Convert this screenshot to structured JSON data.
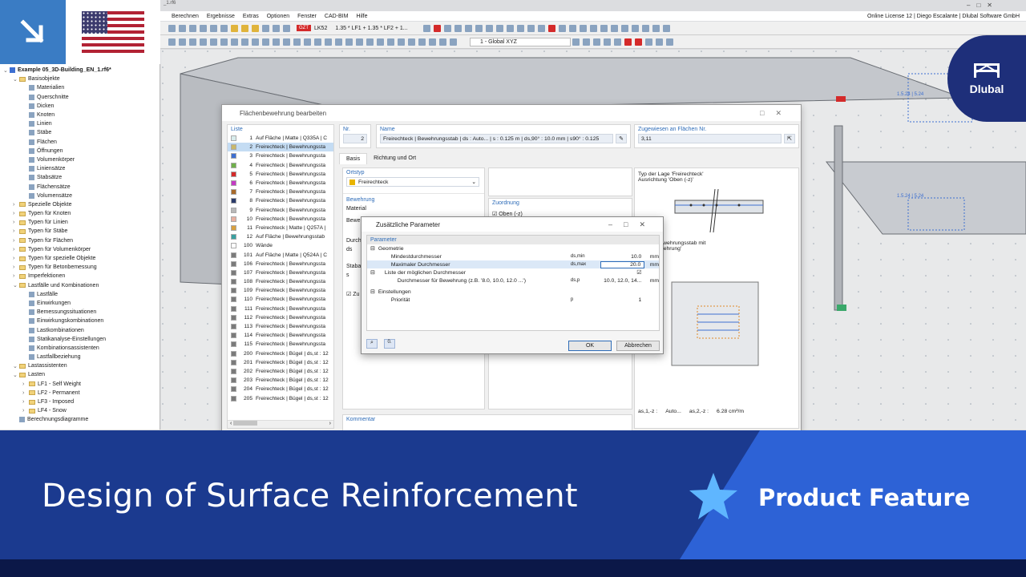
{
  "app": {
    "title_fragment": "_1.rf6",
    "menus": [
      "Berechnen",
      "Ergebnisse",
      "Extras",
      "Optionen",
      "Fenster",
      "CAD-BIM",
      "Hilfe"
    ],
    "license": "Online License 12 | Diego Escalante | Dlubal Software GmbH",
    "load_combo_tag": "GZT",
    "load_combo_id": "LK52",
    "load_combo_formula": "1.35 * LF1 + 1.35 * LF2 + 1...",
    "coordinate_system": "1 - Global XYZ"
  },
  "brand": {
    "name": "Dlubal",
    "accent": "#1e2f7a",
    "corner_blue": "#3a7cc4"
  },
  "tree": {
    "items": [
      {
        "label": "Example 05_3D-Building_EN_1.rf6*",
        "level": 0,
        "type": "file"
      },
      {
        "label": "Basisobjekte",
        "level": 1,
        "type": "folder"
      },
      {
        "label": "Materialien",
        "level": 2,
        "type": "item"
      },
      {
        "label": "Querschnitte",
        "level": 2,
        "type": "item"
      },
      {
        "label": "Dicken",
        "level": 2,
        "type": "item"
      },
      {
        "label": "Knoten",
        "level": 2,
        "type": "item"
      },
      {
        "label": "Linien",
        "level": 2,
        "type": "item"
      },
      {
        "label": "Stäbe",
        "level": 2,
        "type": "item"
      },
      {
        "label": "Flächen",
        "level": 2,
        "type": "item"
      },
      {
        "label": "Öffnungen",
        "level": 2,
        "type": "item"
      },
      {
        "label": "Volumenkörper",
        "level": 2,
        "type": "item"
      },
      {
        "label": "Liniensätze",
        "level": 2,
        "type": "item"
      },
      {
        "label": "Stabsätze",
        "level": 2,
        "type": "item"
      },
      {
        "label": "Flächensätze",
        "level": 2,
        "type": "item"
      },
      {
        "label": "Volumensätze",
        "level": 2,
        "type": "item"
      },
      {
        "label": "Spezielle Objekte",
        "level": 1,
        "type": "folder"
      },
      {
        "label": "Typen für Knoten",
        "level": 1,
        "type": "folder"
      },
      {
        "label": "Typen für Linien",
        "level": 1,
        "type": "folder"
      },
      {
        "label": "Typen für Stäbe",
        "level": 1,
        "type": "folder"
      },
      {
        "label": "Typen für Flächen",
        "level": 1,
        "type": "folder"
      },
      {
        "label": "Typen für Volumenkörper",
        "level": 1,
        "type": "folder"
      },
      {
        "label": "Typen für spezielle Objekte",
        "level": 1,
        "type": "folder"
      },
      {
        "label": "Typen für Betonbemessung",
        "level": 1,
        "type": "folder"
      },
      {
        "label": "Imperfektionen",
        "level": 1,
        "type": "folder"
      },
      {
        "label": "Lastfälle und Kombinationen",
        "level": 1,
        "type": "folder"
      },
      {
        "label": "Lastfälle",
        "level": 2,
        "type": "item"
      },
      {
        "label": "Einwirkungen",
        "level": 2,
        "type": "item"
      },
      {
        "label": "Bemessungssituationen",
        "level": 2,
        "type": "item"
      },
      {
        "label": "Einwirkungskombinationen",
        "level": 2,
        "type": "item"
      },
      {
        "label": "Lastkombinationen",
        "level": 2,
        "type": "item"
      },
      {
        "label": "Statikanalyse-Einstellungen",
        "level": 2,
        "type": "item"
      },
      {
        "label": "Kombinationsassistenten",
        "level": 2,
        "type": "item"
      },
      {
        "label": "Lastfallbeziehung",
        "level": 2,
        "type": "item"
      },
      {
        "label": "Lastassistenten",
        "level": 1,
        "type": "folder"
      },
      {
        "label": "Lasten",
        "level": 1,
        "type": "folder"
      },
      {
        "label": "LF1 - Self Weight",
        "level": 2,
        "type": "folder"
      },
      {
        "label": "LF2 - Permanent",
        "level": 2,
        "type": "folder"
      },
      {
        "label": "LF3 - Imposed",
        "level": 2,
        "type": "folder"
      },
      {
        "label": "LF4 - Snow",
        "level": 2,
        "type": "folder"
      },
      {
        "label": "Berechnungsdiagramme",
        "level": 1,
        "type": "item"
      }
    ]
  },
  "dialog": {
    "title": "Flächenbewehrung bearbeiten",
    "list_header": "Liste",
    "nr_header": "Nr.",
    "nr_value": "2",
    "name_header": "Name",
    "name_value": "Freirechteck | Bewehrungsstab | ds : Auto... | s : 0.125 m | ds,90° : 10.0 mm | s90° : 0.125",
    "assigned_header": "Zugewiesen an Flächen Nr.",
    "assigned_value": "3,11",
    "tabs": [
      "Basis",
      "Richtung und Ort"
    ],
    "ortstyp_label": "Ortstyp",
    "ortstyp_value": "Freirechteck",
    "bewehrung_label": "Bewehrung",
    "material_label": "Material",
    "zuordnung_label": "Zuordnung",
    "oben_label": "Oben (-z)",
    "kommentar_label": "Kommentar",
    "preview_text1": "Typ der Lage 'Freirechteck'",
    "preview_text2": "Ausrichtung 'Oben (-z)'",
    "preview_text3": "sgstyp 'Bewehrungsstab mit",
    "preview_text4": "r Querbewehrung'",
    "area_label1": "as,1,-z :",
    "area_value1": "Auto...",
    "area_label2": "as,2,-z :",
    "area_value2": "6.28 cm²/m",
    "partial_labels": [
      "Bewe",
      "Durch",
      "ds",
      "Staba",
      "s",
      "Zu",
      "a",
      "ja"
    ],
    "list_items": [
      {
        "nr": "1",
        "text": "Auf Fläche | Matte | Q335A | C",
        "color": "#d8ecec"
      },
      {
        "nr": "2",
        "text": "Freirechteck | Bewehrungssta",
        "color": "#c9b86b",
        "selected": true
      },
      {
        "nr": "3",
        "text": "Freirechteck | Bewehrungssta",
        "color": "#3d6fd1"
      },
      {
        "nr": "4",
        "text": "Freirechteck | Bewehrungssta",
        "color": "#6fb04a"
      },
      {
        "nr": "5",
        "text": "Freirechteck | Bewehrungssta",
        "color": "#d42a2a"
      },
      {
        "nr": "6",
        "text": "Freirechteck | Bewehrungssta",
        "color": "#c43ac4"
      },
      {
        "nr": "7",
        "text": "Freirechteck | Bewehrungssta",
        "color": "#a86a2a"
      },
      {
        "nr": "8",
        "text": "Freirechteck | Bewehrungssta",
        "color": "#2a3a6a"
      },
      {
        "nr": "9",
        "text": "Freirechteck | Bewehrungssta",
        "color": "#b8b8b8"
      },
      {
        "nr": "10",
        "text": "Freirechteck | Bewehrungssta",
        "color": "#e8b0a0"
      },
      {
        "nr": "11",
        "text": "Freirechteck | Matte | Q257A |",
        "color": "#d8a040"
      },
      {
        "nr": "12",
        "text": "Auf Fläche | Bewehrungsstab",
        "color": "#3aa0a0"
      },
      {
        "nr": "100",
        "text": "Wände",
        "color": "#ffffff"
      },
      {
        "nr": "101",
        "text": "Auf Fläche | Matte | Q524A | C",
        "color": "#7a7a7a"
      },
      {
        "nr": "106",
        "text": "Freirechteck | Bewehrungssta",
        "color": "#7a7a7a"
      },
      {
        "nr": "107",
        "text": "Freirechteck | Bewehrungssta",
        "color": "#7a7a7a"
      },
      {
        "nr": "108",
        "text": "Freirechteck | Bewehrungssta",
        "color": "#7a7a7a"
      },
      {
        "nr": "109",
        "text": "Freirechteck | Bewehrungssta",
        "color": "#7a7a7a"
      },
      {
        "nr": "110",
        "text": "Freirechteck | Bewehrungssta",
        "color": "#7a7a7a"
      },
      {
        "nr": "111",
        "text": "Freirechteck | Bewehrungssta",
        "color": "#7a7a7a"
      },
      {
        "nr": "112",
        "text": "Freirechteck | Bewehrungssta",
        "color": "#7a7a7a"
      },
      {
        "nr": "113",
        "text": "Freirechteck | Bewehrungssta",
        "color": "#7a7a7a"
      },
      {
        "nr": "114",
        "text": "Freirechteck | Bewehrungssta",
        "color": "#7a7a7a"
      },
      {
        "nr": "115",
        "text": "Freirechteck | Bewehrungssta",
        "color": "#7a7a7a"
      },
      {
        "nr": "200",
        "text": "Freirechteck | Bügel | ds,st : 12",
        "color": "#7a7a7a"
      },
      {
        "nr": "201",
        "text": "Freirechteck | Bügel | ds,st : 12",
        "color": "#7a7a7a"
      },
      {
        "nr": "202",
        "text": "Freirechteck | Bügel | ds,st : 12",
        "color": "#7a7a7a"
      },
      {
        "nr": "203",
        "text": "Freirechteck | Bügel | ds,st : 12",
        "color": "#7a7a7a"
      },
      {
        "nr": "204",
        "text": "Freirechteck | Bügel | ds,st : 12",
        "color": "#7a7a7a"
      },
      {
        "nr": "205",
        "text": "Freirechteck | Bügel | ds,st : 12",
        "color": "#7a7a7a"
      }
    ]
  },
  "subdialog": {
    "title": "Zusätzliche Parameter",
    "param_header": "Parameter",
    "rows": [
      {
        "label": "Geometrie",
        "sym": "",
        "value": "",
        "unit": "",
        "indent": 0,
        "group": true
      },
      {
        "label": "Mindestdurchmesser",
        "sym": "ds,min",
        "value": "10.0",
        "unit": "mm",
        "indent": 2
      },
      {
        "label": "Maximaler Durchmesser",
        "sym": "ds,max",
        "value": "20.0",
        "unit": "mm",
        "indent": 2,
        "editing": true
      },
      {
        "label": "Liste der möglichen Durchmesser",
        "sym": "",
        "value": "☑",
        "unit": "",
        "indent": 1,
        "group": true
      },
      {
        "label": "Durchmesser für Bewehrung (z.B. '8.0, 10.0, 12.0 ...')",
        "sym": "ds,p",
        "value": "10.0, 12.0, 14...",
        "unit": "mm",
        "indent": 3
      }
    ],
    "rows2": [
      {
        "label": "Einstellungen",
        "sym": "",
        "value": "",
        "unit": "",
        "indent": 0,
        "group": true
      },
      {
        "label": "Priorität",
        "sym": "p",
        "value": "1",
        "unit": "",
        "indent": 2
      }
    ],
    "ok": "OK",
    "cancel": "Abbrechen"
  },
  "viewport": {
    "dim_labels": [
      "1.5.24 | 5.24",
      "1.5.24 | 5.24"
    ]
  },
  "banner": {
    "title": "Design of Surface Reinforcement",
    "tag": "Product Feature",
    "colors": {
      "left": "#1b3a8f",
      "right": "#2d62d6",
      "star": "#5fb6ff"
    }
  }
}
